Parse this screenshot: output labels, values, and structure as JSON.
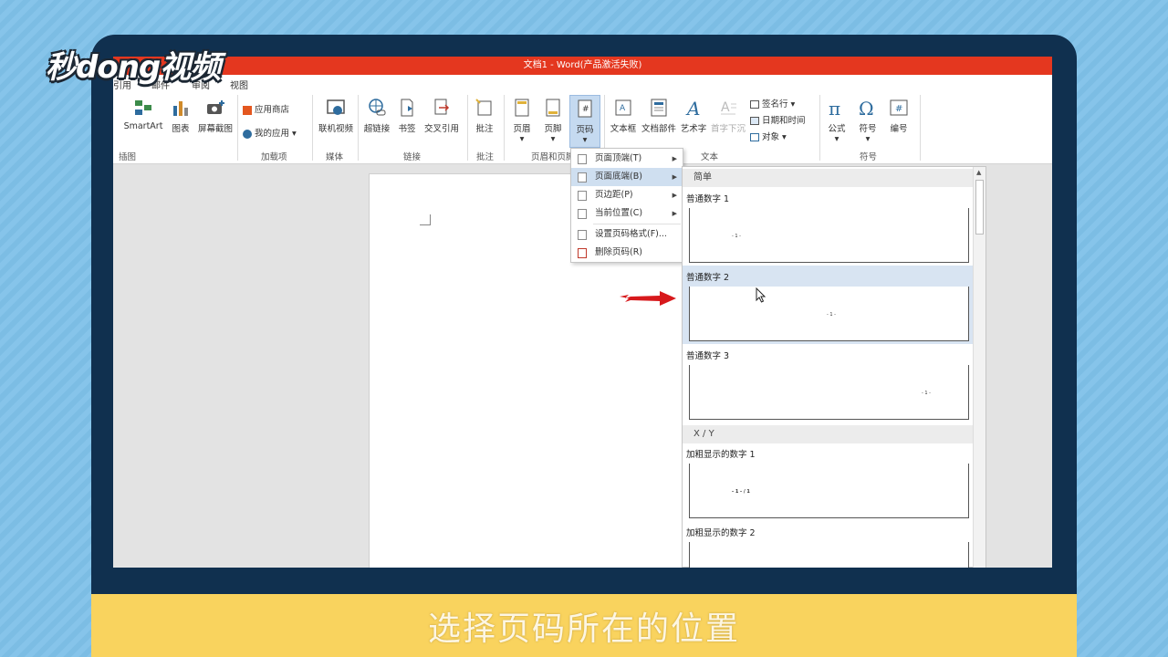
{
  "logo": {
    "text": "秒dong视频"
  },
  "window": {
    "title": "文档1 - Word(产品激活失败)"
  },
  "menubar": [
    "引用",
    "邮件",
    "审阅",
    "视图"
  ],
  "ribbon": {
    "buttons": {
      "smartart": "SmartArt",
      "chart": "图表",
      "screenshot": "屏幕截图",
      "appstore": "应用商店",
      "myapps": "我的应用",
      "online_video": "联机视频",
      "hyperlink": "超链接",
      "bookmark": "书签",
      "crossref": "交叉引用",
      "comment": "批注",
      "header": "页眉",
      "footer": "页脚",
      "pagenum": "页码",
      "textbox": "文本框",
      "quickparts": "文档部件",
      "wordart": "艺术字",
      "dropcap": "首字下沉",
      "signature": "签名行",
      "datetime": "日期和时间",
      "object": "对象",
      "equation": "公式",
      "symbol": "符号",
      "number": "编号"
    },
    "groups": {
      "illustrations": "插图",
      "addins": "加载项",
      "media": "媒体",
      "links": "链接",
      "comments": "批注",
      "headerfooter": "页眉和页脚",
      "text": "文本",
      "symbols": "符号"
    }
  },
  "pagenum_menu": [
    {
      "label": "页面顶端(T)"
    },
    {
      "label": "页面底端(B)"
    },
    {
      "label": "页边距(P)"
    },
    {
      "label": "当前位置(C)"
    },
    {
      "label": "设置页码格式(F)..."
    },
    {
      "label": "删除页码(R)"
    }
  ],
  "gallery": {
    "section_simple": "简单",
    "item1": "普通数字 1",
    "item2": "普通数字 2",
    "item3": "普通数字 3",
    "section_xy": "X / Y",
    "item4": "加粗显示的数字 1",
    "item5": "加粗显示的数字 2",
    "thumb_num": "- 1 -",
    "thumb_num_xy": "- 1 - / 1"
  },
  "caption": "选择页码所在的位置",
  "colors": {
    "titlebar": "#e4371f",
    "monitor": "#10304f",
    "caption_bar": "#f9d35e",
    "highlight": "#d8e4f2"
  }
}
